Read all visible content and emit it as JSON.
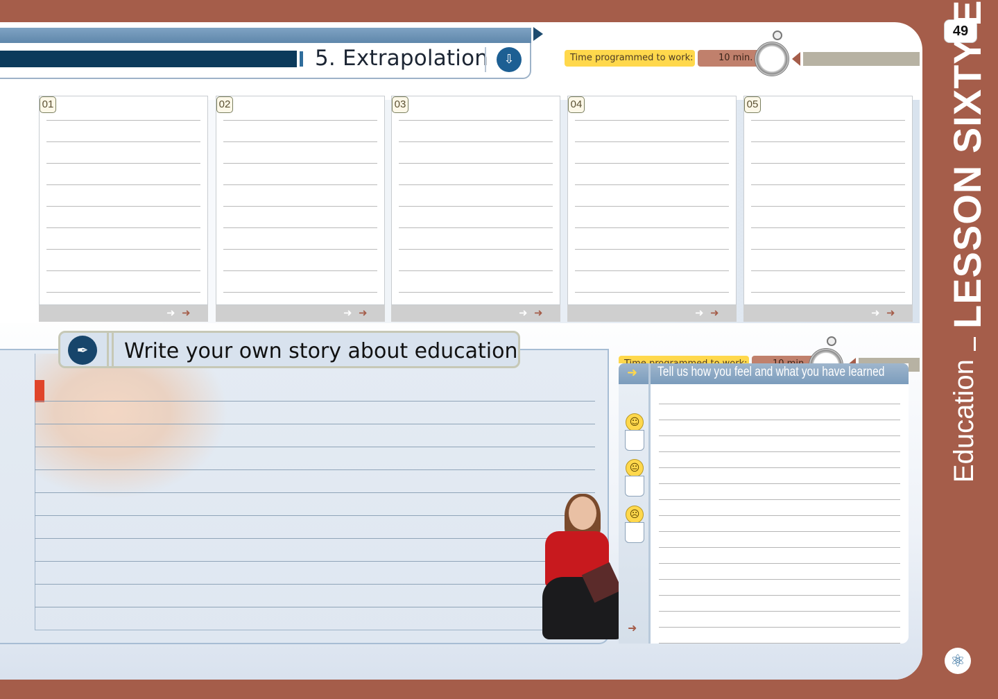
{
  "page_number": "49",
  "header": {
    "title": "5. Extrapolation"
  },
  "time_rows": [
    {
      "label": "Time programmed to work:",
      "value": "10 min."
    },
    {
      "label": "Time programmed to work:",
      "value": "10 min."
    }
  ],
  "cards": [
    {
      "number": "01"
    },
    {
      "number": "02"
    },
    {
      "number": "03"
    },
    {
      "number": "04"
    },
    {
      "number": "05"
    }
  ],
  "story": {
    "title": "Write your own story about education"
  },
  "feelings": {
    "title": "Tell us how you feel and what you have learned",
    "faces": [
      "☺",
      "😐",
      "☹"
    ]
  },
  "side": {
    "lesson": "LESSON SIXTY-EIGHT",
    "topic": "Education"
  },
  "colors": {
    "brand_rust": "#a55d4a",
    "header_navy": "#0c3a5b",
    "time_label_yellow": "#ffd84c",
    "time_value_rust": "#c0806c",
    "panel_blue": "#7b9cbc",
    "accent_red": "#e0452a"
  }
}
